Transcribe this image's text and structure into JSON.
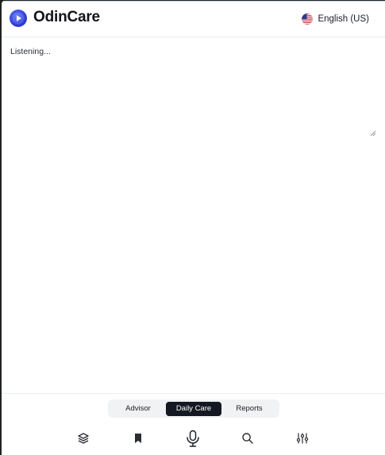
{
  "app": {
    "brand": "OdinCare",
    "language": "English (US)"
  },
  "transcript": {
    "placeholder": "Listening...",
    "value": ""
  },
  "tabs": [
    {
      "label": "Advisor",
      "active": false
    },
    {
      "label": "Daily Care",
      "active": true
    },
    {
      "label": "Reports",
      "active": false
    }
  ],
  "toolbar": {
    "icons": [
      "layers-icon",
      "bookmark-icon",
      "microphone-icon",
      "search-icon",
      "sliders-icon"
    ]
  },
  "colors": {
    "brand": "#2f3fd6",
    "active_tab": "#141822",
    "tab_track": "#f1f2f4"
  }
}
